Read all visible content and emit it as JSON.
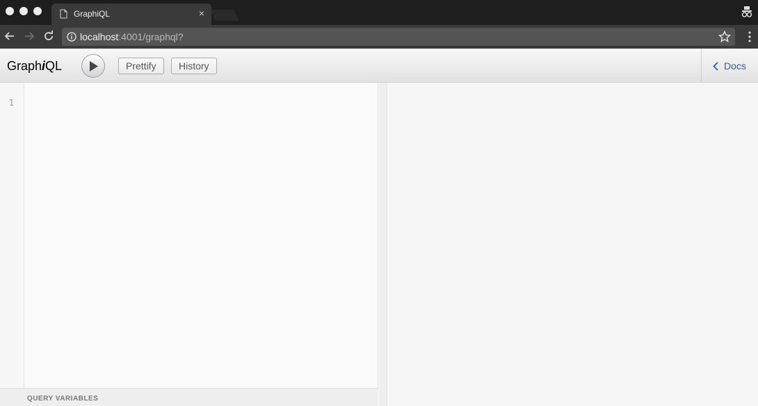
{
  "browser": {
    "tab_title": "GraphiQL",
    "tab_close": "×",
    "url_host": "localhost",
    "url_path": ":4001/graphql?"
  },
  "app": {
    "logo_prefix": "Graph",
    "logo_i": "i",
    "logo_suffix": "QL",
    "prettify_label": "Prettify",
    "history_label": "History",
    "docs_label": "Docs",
    "line_number": "1",
    "query_variables_title": "QUERY VARIABLES"
  },
  "colors": {
    "docs_link": "#3b5998",
    "toolbar_top": "#f7f7f7",
    "toolbar_bottom": "#e2e2e2"
  }
}
